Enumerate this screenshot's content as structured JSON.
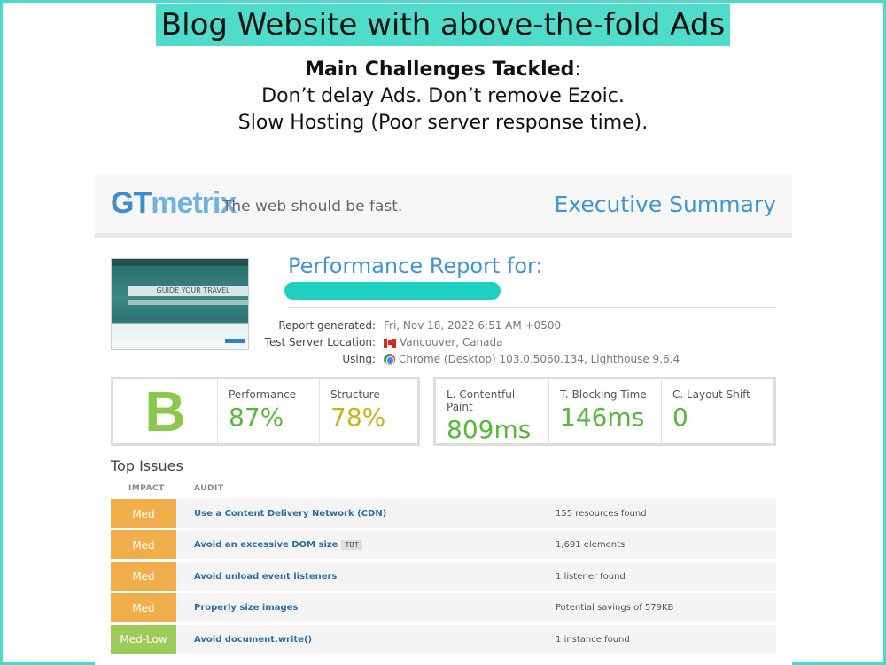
{
  "banner": "Blog Website with above-the-fold Ads",
  "challenges": {
    "heading": "Main Challenges Tackled",
    "line1": "Don’t delay Ads. Don’t remove Ezoic.",
    "line2": "Slow Hosting (Poor server response time)."
  },
  "report": {
    "logo_gt": "GT",
    "logo_metrix": "metrix",
    "tagline": "The web should be fast.",
    "executive_summary": "Executive Summary",
    "performance_title": "Performance Report for:",
    "thumbnail_text": "GUIDE YOUR TRAVEL",
    "meta": [
      {
        "key": "Report generated:",
        "value": "Fri, Nov 18, 2022 6:51 AM +0500",
        "icon": ""
      },
      {
        "key": "Test Server Location:",
        "value": "Vancouver, Canada",
        "icon": "canada-flag-icon"
      },
      {
        "key": "Using:",
        "value": "Chrome (Desktop) 103.0.5060.134, Lighthouse 9.6.4",
        "icon": "chrome-icon"
      }
    ],
    "grade": "B",
    "performance": {
      "label": "Performance",
      "value": "87%"
    },
    "structure": {
      "label": "Structure",
      "value": "78%"
    },
    "lcp": {
      "label": "L. Contentful Paint",
      "value": "809ms"
    },
    "tbt": {
      "label": "T. Blocking Time",
      "value": "146ms"
    },
    "cls": {
      "label": "C. Layout Shift",
      "value": "0"
    },
    "top_issues_title": "Top Issues",
    "col_impact": "IMPACT",
    "col_audit": "AUDIT",
    "issues": [
      {
        "impact": "Med",
        "audit": "Use a Content Delivery Network (CDN)",
        "tag": "",
        "result": "155 resources found"
      },
      {
        "impact": "Med",
        "audit": "Avoid an excessive DOM size",
        "tag": "TBT",
        "result": "1,691 elements"
      },
      {
        "impact": "Med",
        "audit": "Avoid unload event listeners",
        "tag": "",
        "result": "1 listener found"
      },
      {
        "impact": "Med",
        "audit": "Properly size images",
        "tag": "",
        "result": "Potential savings of 579KB"
      },
      {
        "impact": "Med-Low",
        "audit": "Avoid document.write()",
        "tag": "",
        "result": "1 instance found"
      }
    ]
  },
  "colors": {
    "frame": "#4dd9c9",
    "med": "#f2ae4b",
    "med_low": "#9ccb5a",
    "accent": "#3d95d2"
  }
}
